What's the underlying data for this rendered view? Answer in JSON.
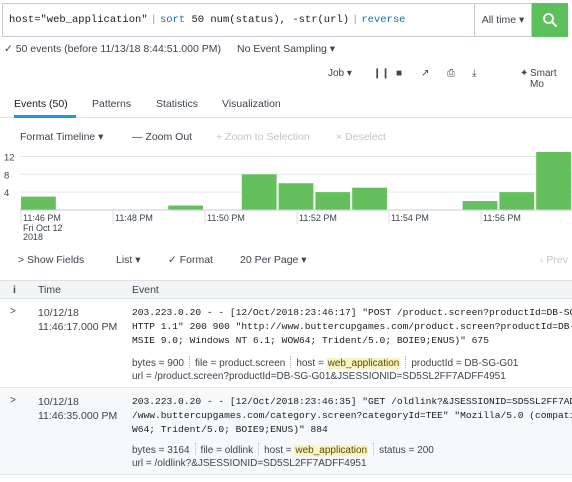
{
  "search": {
    "query_host": "host=\"web_application\"",
    "query_cmd1": "sort",
    "query_cmd1_args": "50 num(status), -str(url)",
    "query_cmd2": "reverse",
    "time_range": "All time ▾"
  },
  "summary": {
    "events_text": "✓ 50 events (before 11/13/18 8:44:51.000 PM)",
    "sampling": "No Event Sampling ▾"
  },
  "jobbar": {
    "job": "Job ▾",
    "smart_mode": "Smart Mo"
  },
  "tabs": [
    {
      "label": "Events (50)"
    },
    {
      "label": "Patterns"
    },
    {
      "label": "Statistics"
    },
    {
      "label": "Visualization"
    }
  ],
  "timeline_controls": {
    "format": "Format Timeline ▾",
    "zoom_out": "— Zoom Out",
    "zoom_selection": "+ Zoom to Selection",
    "deselect": "× Deselect"
  },
  "chart_data": {
    "type": "bar",
    "y_ticks": [
      "12",
      "8",
      "4"
    ],
    "x_ticks": [
      "11:46 PM",
      "11:48 PM",
      "11:50 PM",
      "11:52 PM",
      "11:54 PM",
      "11:56 PM"
    ],
    "x_date_label": [
      "Fri Oct 12",
      "2018"
    ],
    "values": [
      3,
      0,
      0,
      0,
      1,
      0,
      8,
      6,
      4,
      5,
      0,
      0,
      2,
      4,
      13
    ],
    "ylim": [
      0,
      13
    ],
    "color": "#65bf5c"
  },
  "fields_bar": {
    "show_fields": "> Show Fields",
    "list": "List ▾",
    "format": "✓ Format",
    "per_page": "20 Per Page ▾",
    "prev": "‹ Prev"
  },
  "table": {
    "col_info": "i",
    "col_time": "Time",
    "col_event": "Event"
  },
  "events": [
    {
      "expand": ">",
      "date": "10/12/18",
      "time": "11:46:17.000 PM",
      "raw": "203.223.0.20 - - [12/Oct/2018:23:46:17] \"POST /product.screen?productId=DB-SG-G01&JSES\nHTTP 1.1\" 200 900 \"http://www.buttercupgames.com/product.screen?productId=DB-SG-G01\" \"Mo\nMSIE 9.0; Windows NT 6.1; WOW64; Trident/5.0; BOIE9;ENUS)\" 675",
      "f_bytes": "bytes = 900",
      "f_file": "file = product.screen",
      "f_host_k": "host = ",
      "f_host_v": "web_application",
      "f_extra": "productId = DB-SG-G01",
      "url": "url = /product.screen?productId=DB-SG-G01&JSESSIONID=SD5SL2FF7ADFF4951"
    },
    {
      "expand": ">",
      "date": "10/12/18",
      "time": "11:46:35.000 PM",
      "raw": "203.223.0.20 - - [12/Oct/2018:23:46:35] \"GET /oldlink?&JSESSIONID=SD5SL2FF7ADFF4951 HTT\n/www.buttercupgames.com/category.screen?categoryId=TEE\" \"Mozilla/5.0 (compatible; MSIE\nW64; Trident/5.0; BOIE9;ENUS)\" 884",
      "f_bytes": "bytes = 3164",
      "f_file": "file = oldlink",
      "f_host_k": "host = ",
      "f_host_v": "web_application",
      "f_extra": "status = 200",
      "url": "url = /oldlink?&JSESSIONID=SD5SL2FF7ADFF4951"
    }
  ]
}
